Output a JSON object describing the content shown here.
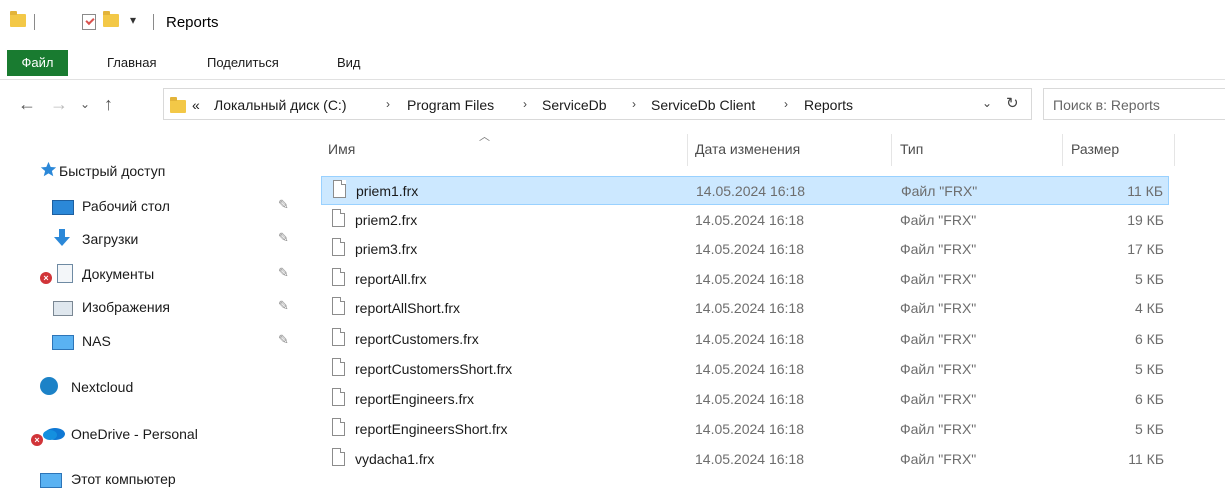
{
  "window": {
    "title": "Reports"
  },
  "ribbon": {
    "tabs": [
      "Файл",
      "Главная",
      "Поделиться",
      "Вид"
    ]
  },
  "address": {
    "overflow": "«",
    "crumbs": [
      "Локальный диск (C:)",
      "Program Files",
      "ServiceDb",
      "ServiceDb Client",
      "Reports"
    ],
    "search_placeholder": "Поиск в: Reports"
  },
  "sidebar": {
    "quick_access": "Быстрый доступ",
    "items": [
      {
        "label": "Рабочий стол",
        "icon": "desktop-icon",
        "pinned": true
      },
      {
        "label": "Загрузки",
        "icon": "download-icon",
        "pinned": true
      },
      {
        "label": "Документы",
        "icon": "documents-icon",
        "pinned": true,
        "error": true
      },
      {
        "label": "Изображения",
        "icon": "pictures-icon",
        "pinned": true
      },
      {
        "label": "NAS",
        "icon": "network-drive-icon",
        "pinned": true
      }
    ],
    "nextcloud": "Nextcloud",
    "onedrive": "OneDrive - Personal",
    "this_pc": "Этот компьютер"
  },
  "columns": {
    "name": "Имя",
    "date": "Дата изменения",
    "type": "Тип",
    "size": "Размер"
  },
  "files": [
    {
      "name": "priem1.frx",
      "date": "14.05.2024 16:18",
      "type": "Файл \"FRX\"",
      "size": "11 КБ",
      "selected": true
    },
    {
      "name": "priem2.frx",
      "date": "14.05.2024 16:18",
      "type": "Файл \"FRX\"",
      "size": "19 КБ"
    },
    {
      "name": "priem3.frx",
      "date": "14.05.2024 16:18",
      "type": "Файл \"FRX\"",
      "size": "17 КБ"
    },
    {
      "name": "reportAll.frx",
      "date": "14.05.2024 16:18",
      "type": "Файл \"FRX\"",
      "size": "5 КБ"
    },
    {
      "name": "reportAllShort.frx",
      "date": "14.05.2024 16:18",
      "type": "Файл \"FRX\"",
      "size": "4 КБ"
    },
    {
      "name": "reportCustomers.frx",
      "date": "14.05.2024 16:18",
      "type": "Файл \"FRX\"",
      "size": "6 КБ"
    },
    {
      "name": "reportCustomersShort.frx",
      "date": "14.05.2024 16:18",
      "type": "Файл \"FRX\"",
      "size": "5 КБ"
    },
    {
      "name": "reportEngineers.frx",
      "date": "14.05.2024 16:18",
      "type": "Файл \"FRX\"",
      "size": "6 КБ"
    },
    {
      "name": "reportEngineersShort.frx",
      "date": "14.05.2024 16:18",
      "type": "Файл \"FRX\"",
      "size": "5 КБ"
    },
    {
      "name": "vydacha1.frx",
      "date": "14.05.2024 16:18",
      "type": "Файл \"FRX\"",
      "size": "11 КБ"
    }
  ]
}
